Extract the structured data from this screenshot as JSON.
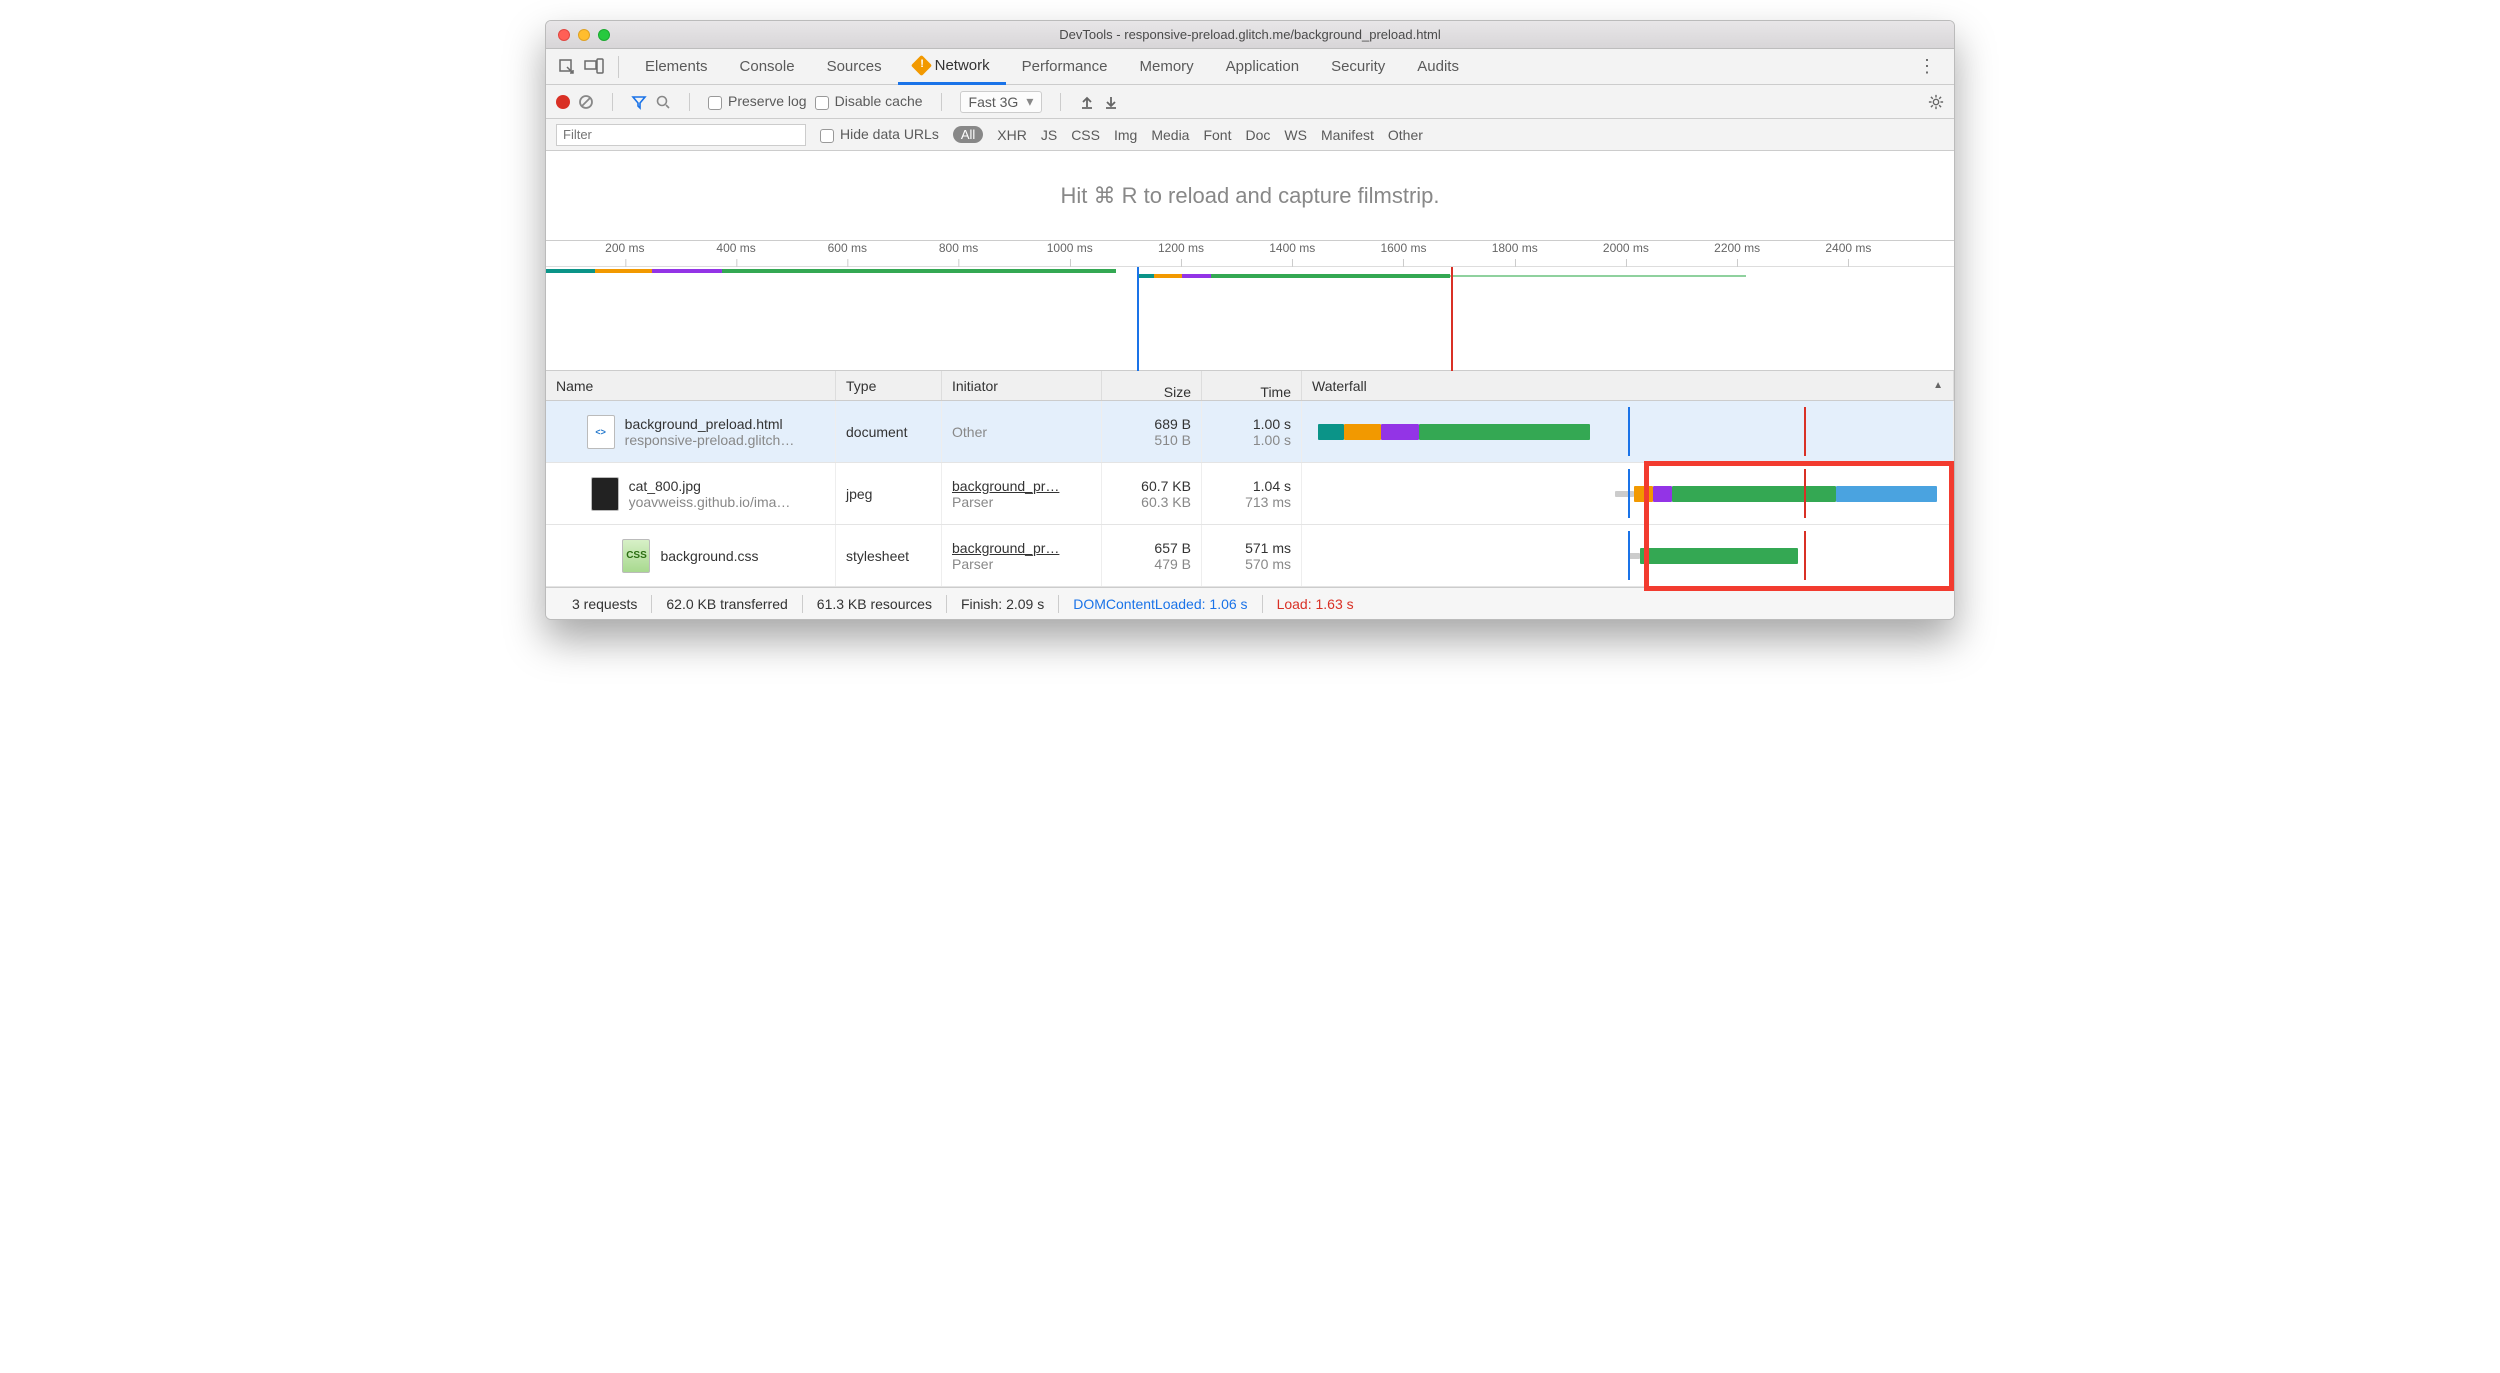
{
  "window": {
    "title": "DevTools - responsive-preload.glitch.me/background_preload.html"
  },
  "panels": [
    "Elements",
    "Console",
    "Sources",
    "Network",
    "Performance",
    "Memory",
    "Application",
    "Security",
    "Audits"
  ],
  "active_panel": "Network",
  "toolbar": {
    "preserve_log": "Preserve log",
    "disable_cache": "Disable cache",
    "throttle": "Fast 3G"
  },
  "filter": {
    "placeholder": "Filter",
    "hide_data_urls": "Hide data URLs",
    "all": "All",
    "types": [
      "XHR",
      "JS",
      "CSS",
      "Img",
      "Media",
      "Font",
      "Doc",
      "WS",
      "Manifest",
      "Other"
    ]
  },
  "hint": "Hit ⌘ R to reload and capture filmstrip.",
  "ruler_ticks": [
    "200 ms",
    "400 ms",
    "600 ms",
    "800 ms",
    "1000 ms",
    "1200 ms",
    "1400 ms",
    "1600 ms",
    "1800 ms",
    "2000 ms",
    "2200 ms",
    "2400 ms"
  ],
  "columns": {
    "name": "Name",
    "type": "Type",
    "initiator": "Initiator",
    "size": "Size",
    "time": "Time",
    "waterfall": "Waterfall"
  },
  "rows": [
    {
      "name": "background_preload.html",
      "host": "responsive-preload.glitch…",
      "type": "document",
      "initiator": "Other",
      "initiator_sub": "",
      "size": "689 B",
      "size_sub": "510 B",
      "time": "1.00 s",
      "time_sub": "1.00 s",
      "icon": "html"
    },
    {
      "name": "cat_800.jpg",
      "host": "yoavweiss.github.io/ima…",
      "type": "jpeg",
      "initiator": "background_pr…",
      "initiator_sub": "Parser",
      "size": "60.7 KB",
      "size_sub": "60.3 KB",
      "time": "1.04 s",
      "time_sub": "713 ms",
      "icon": "img"
    },
    {
      "name": "background.css",
      "host": "",
      "type": "stylesheet",
      "initiator": "background_pr…",
      "initiator_sub": "Parser",
      "size": "657 B",
      "size_sub": "479 B",
      "time": "571 ms",
      "time_sub": "570 ms",
      "icon": "css"
    }
  ],
  "status": {
    "requests": "3 requests",
    "transferred": "62.0 KB transferred",
    "resources": "61.3 KB resources",
    "finish": "Finish: 2.09 s",
    "dcl": "DOMContentLoaded: 1.06 s",
    "load": "Load: 1.63 s"
  },
  "colors": {
    "teal": "#0b9488",
    "orange": "#f29900",
    "purple": "#9334e6",
    "green": "#34a853",
    "blue": "#1a73e8",
    "red": "#d93025",
    "ltgreen": "#54b158"
  }
}
